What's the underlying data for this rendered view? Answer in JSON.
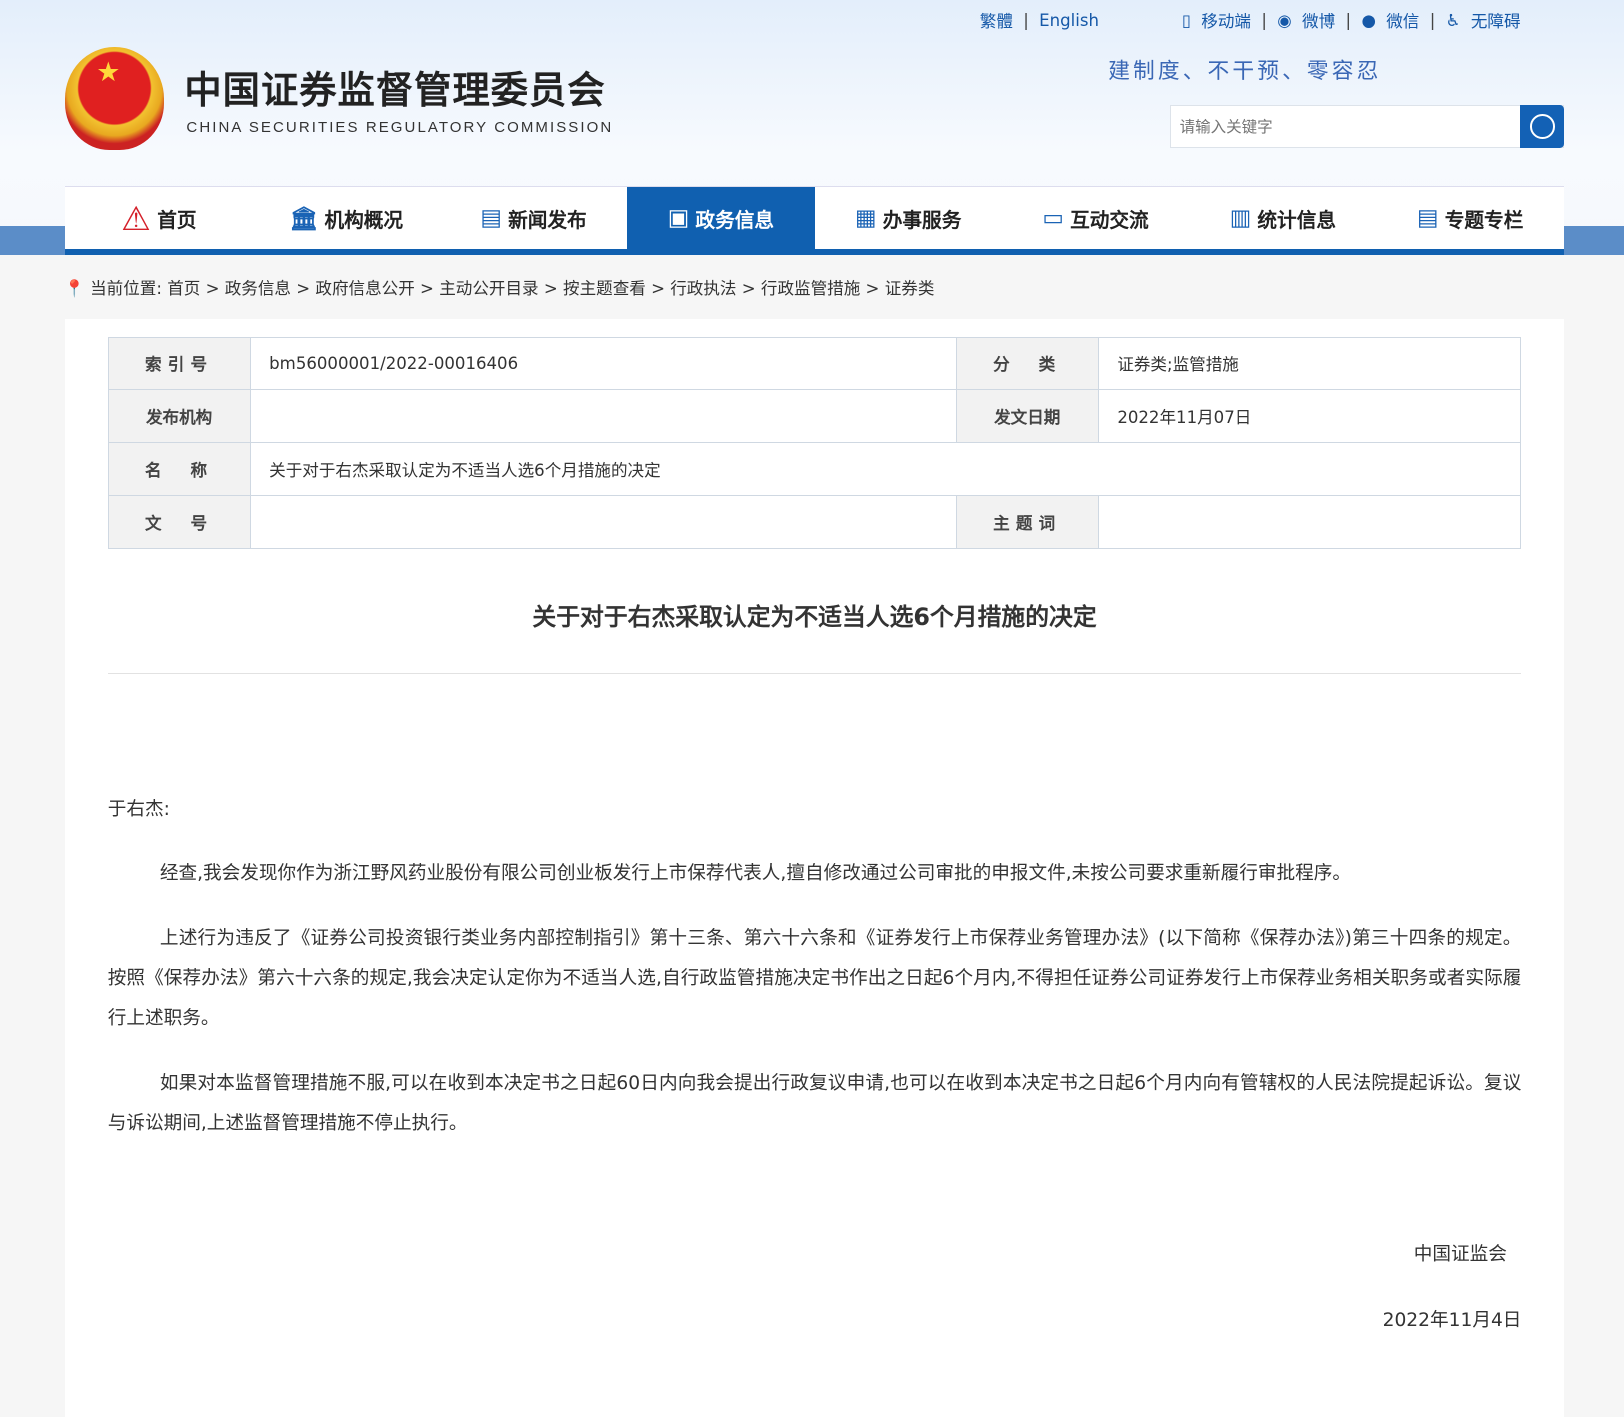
{
  "header": {
    "title_cn": "中国证券监督管理委员会",
    "title_en": "CHINA SECURITIES REGULATORY COMMISSION",
    "slogan": "建制度、不干预、零容忍",
    "top_links": [
      "繁體",
      "English",
      "移动端",
      "微博",
      "微信",
      "无障碍"
    ],
    "search_placeholder": "请输入关键字"
  },
  "nav": [
    {
      "label": "首页",
      "icon": "home-logo-icon"
    },
    {
      "label": "机构概况",
      "icon": "building-icon"
    },
    {
      "label": "新闻发布",
      "icon": "news-icon"
    },
    {
      "label": "政务信息",
      "icon": "monitor-icon",
      "active": true
    },
    {
      "label": "办事服务",
      "icon": "service-icon"
    },
    {
      "label": "互动交流",
      "icon": "chat-icon"
    },
    {
      "label": "统计信息",
      "icon": "bar-chart-icon"
    },
    {
      "label": "专题专栏",
      "icon": "document-icon"
    }
  ],
  "breadcrumb": {
    "prefix": "当前位置:",
    "items": [
      "首页",
      "政务信息",
      "政府信息公开",
      "主动公开目录",
      "按主题查看",
      "行政执法",
      "行政监管措施",
      "证券类"
    ]
  },
  "meta": {
    "index_label": "索引号",
    "index_value": "bm56000001/2022-00016406",
    "category_label": "分　类",
    "category_value": "证券类;监管措施",
    "issuer_label": "发布机构",
    "issuer_value": "",
    "date_label": "发文日期",
    "date_value": "2022年11月07日",
    "name_label": "名　称",
    "name_value": "关于对于右杰采取认定为不适当人选6个月措施的决定",
    "docno_label": "文　号",
    "docno_value": "",
    "keyword_label": "主题词",
    "keyword_value": ""
  },
  "document": {
    "title": "关于对于右杰采取认定为不适当人选6个月措施的决定",
    "salutation": "于右杰:",
    "paragraphs": [
      "经查,我会发现你作为浙江野风药业股份有限公司创业板发行上市保荐代表人,擅自修改通过公司审批的申报文件,未按公司要求重新履行审批程序。",
      "上述行为违反了《证券公司投资银行类业务内部控制指引》第十三条、第六十六条和《证券发行上市保荐业务管理办法》(以下简称《保荐办法》)第三十四条的规定。按照《保荐办法》第六十六条的规定,我会决定认定你为不适当人选,自行政监管措施决定书作出之日起6个月内,不得担任证券公司证券发行上市保荐业务相关职务或者实际履行上述职务。",
      "如果对本监督管理措施不服,可以在收到本决定书之日起60日内向我会提出行政复议申请,也可以在收到本决定书之日起6个月内向有管辖权的人民法院提起诉讼。复议与诉讼期间,上述监督管理措施不停止执行。"
    ],
    "signature": "中国证监会",
    "date": "2022年11月4日"
  }
}
